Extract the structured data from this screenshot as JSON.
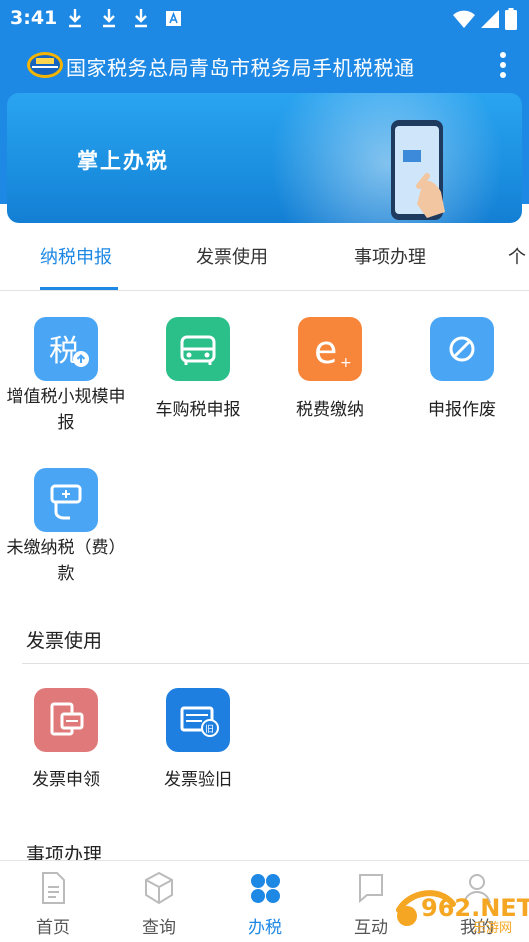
{
  "status_bar": {
    "time": "3:41"
  },
  "app_bar": {
    "title": "国家税务总局青岛市税务局手机税税通"
  },
  "banner": {
    "text": "掌上办税"
  },
  "tabs": [
    {
      "label": "纳税申报",
      "active": true
    },
    {
      "label": "发票使用",
      "active": false
    },
    {
      "label": "事项办理",
      "active": false
    },
    {
      "label": "个",
      "active": false
    }
  ],
  "tax_filing_items": [
    {
      "label": "增值税小规模申报",
      "icon": "tax-upload-icon",
      "color": "#4aa6f5"
    },
    {
      "label": "车购税申报",
      "icon": "car-icon",
      "color": "#2bbf8a"
    },
    {
      "label": "税费缴纳",
      "icon": "e-pay-icon",
      "color": "#f7853a"
    },
    {
      "label": "申报作废",
      "icon": "void-icon",
      "color": "#4aa6f5"
    },
    {
      "label": "未缴纳税（费）款",
      "icon": "unpaid-hand-icon",
      "color": "#4aa6f5"
    }
  ],
  "invoice_section": {
    "title": "发票使用",
    "items": [
      {
        "label": "发票申领",
        "icon": "invoice-apply-icon",
        "color": "#e07a7a"
      },
      {
        "label": "发票验旧",
        "icon": "invoice-check-icon",
        "color": "#1e7fe0"
      }
    ]
  },
  "matters_section": {
    "title": "事项办理"
  },
  "bottom_nav": [
    {
      "label": "首页",
      "icon": "document-icon",
      "active": false
    },
    {
      "label": "查询",
      "icon": "cube-icon",
      "active": false
    },
    {
      "label": "办税",
      "icon": "grid-icon",
      "active": true
    },
    {
      "label": "互动",
      "icon": "chat-icon",
      "active": false
    },
    {
      "label": "我的",
      "icon": "user-icon",
      "active": false
    }
  ],
  "watermark": {
    "text": "962.NET",
    "sub": "乐游网"
  },
  "colors": {
    "primary": "#1e88e5"
  }
}
